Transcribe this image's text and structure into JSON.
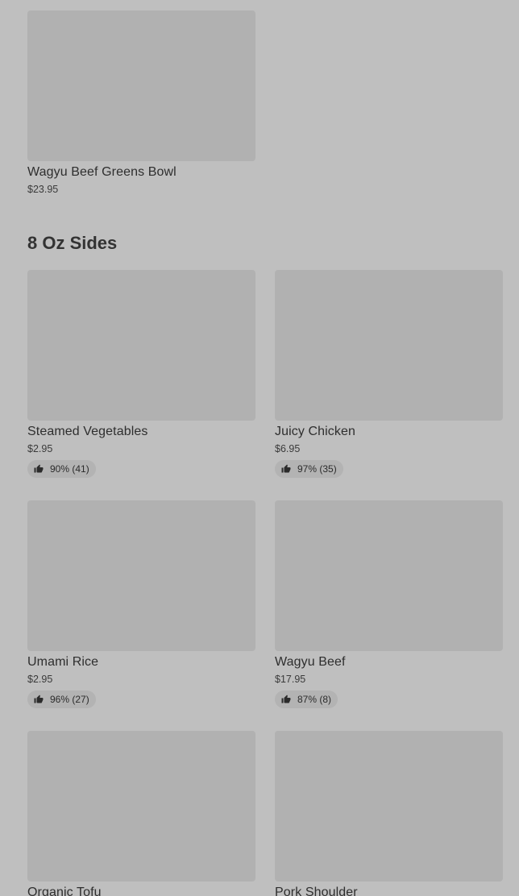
{
  "top_item": {
    "name": "Wagyu Beef Greens Bowl",
    "price": "$23.95"
  },
  "section": {
    "title": "8 Oz Sides"
  },
  "items": [
    {
      "name": "Steamed Vegetables",
      "price": "$2.95",
      "rating": "90% (41)"
    },
    {
      "name": "Juicy Chicken",
      "price": "$6.95",
      "rating": "97% (35)"
    },
    {
      "name": "Umami Rice",
      "price": "$2.95",
      "rating": "96% (27)"
    },
    {
      "name": "Wagyu Beef",
      "price": "$17.95",
      "rating": "87% (8)"
    },
    {
      "name": "Organic Tofu"
    },
    {
      "name": "Pork Shoulder"
    }
  ],
  "icons": {
    "rating": "thumbs-up-icon"
  },
  "colors": {
    "background": "#bfbfbf",
    "thumbnail": "#b1b1b1",
    "text": "#2e2e2e"
  }
}
